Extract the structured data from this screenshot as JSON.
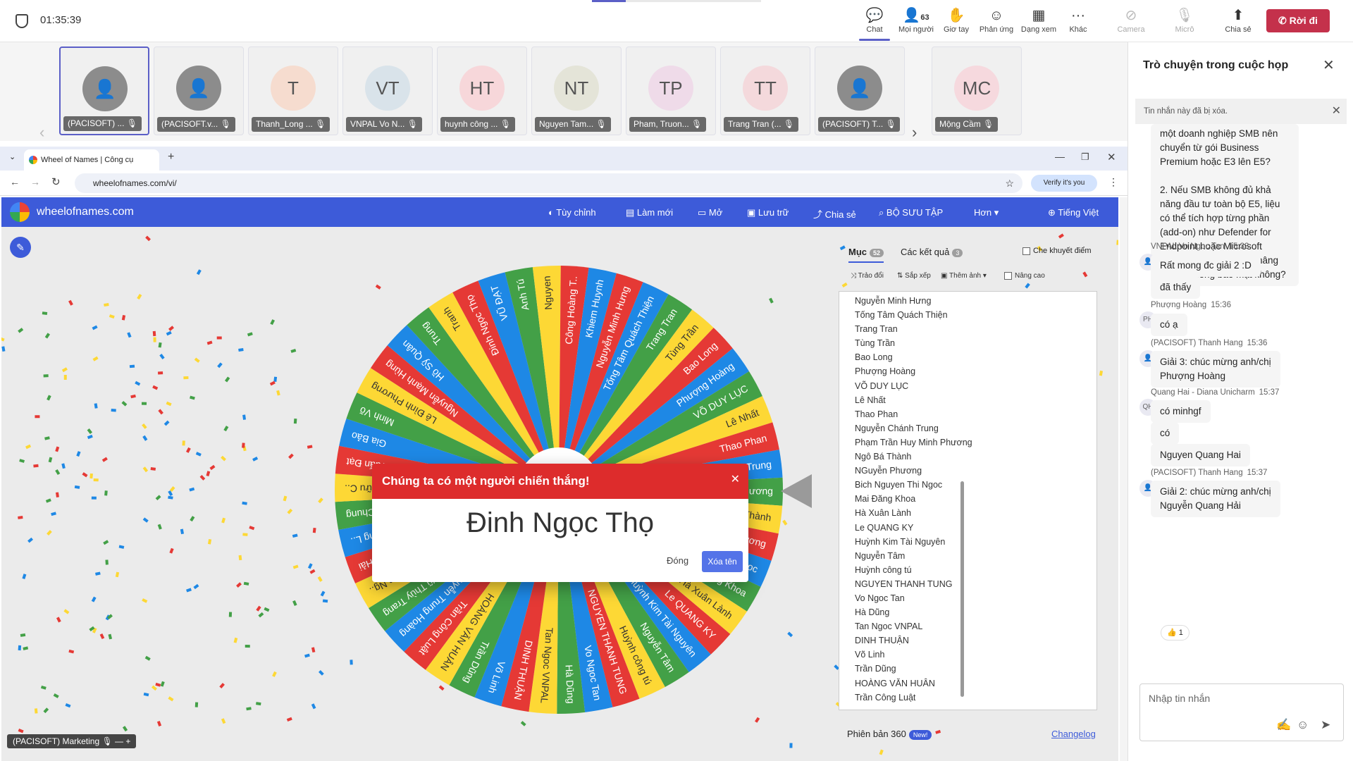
{
  "meeting": {
    "timer": "01:35:39",
    "toolbar": [
      {
        "label": "Chat",
        "icon": "chat-icon",
        "sel": true
      },
      {
        "label": "Mọi người",
        "icon": "people-icon",
        "count": "63"
      },
      {
        "label": "Giơ tay",
        "icon": "raise-hand-icon"
      },
      {
        "label": "Phản ứng",
        "icon": "reaction-icon"
      },
      {
        "label": "Dạng xem",
        "icon": "view-icon"
      },
      {
        "label": "Khác",
        "icon": "more-icon"
      },
      {
        "label": "Camera",
        "icon": "camera-off-icon",
        "off": true
      },
      {
        "label": "Micrô",
        "icon": "mic-off-icon",
        "off": true
      },
      {
        "label": "Chia sẻ",
        "icon": "share-icon"
      }
    ],
    "leave_label": "Rời đi"
  },
  "participants": [
    {
      "initials": "",
      "name": "(PACISOFT) ...",
      "color": "#8c8c8c"
    },
    {
      "initials": "",
      "name": "(PACISOFT.v...",
      "color": "#8c8c8c"
    },
    {
      "initials": "T",
      "name": "Thanh_Long ...",
      "color": "#f6dccf"
    },
    {
      "initials": "VT",
      "name": "VNPAL Vo N...",
      "color": "#d9e3ea"
    },
    {
      "initials": "HT",
      "name": "huynh công ...",
      "color": "#f7d7da"
    },
    {
      "initials": "NT",
      "name": "Nguyen Tam...",
      "color": "#e4e4d8"
    },
    {
      "initials": "TP",
      "name": "Pham, Truon...",
      "color": "#efdbe9"
    },
    {
      "initials": "TT",
      "name": "Trang Tran (...",
      "color": "#f4d9dc"
    },
    {
      "initials": "",
      "name": "(PACISOFT) T...",
      "color": "#8c8c8c"
    },
    {
      "initials": "MC",
      "name": "Mộng Cầm",
      "color": "#f6d9de"
    }
  ],
  "browser": {
    "tab_title": "Wheel of Names | Công cụ",
    "url": "wheelofnames.com/vi/",
    "verify": "Verify it's you"
  },
  "site": {
    "brand": "wheelofnames.com",
    "menu": [
      "Tùy chỉnh",
      "Làm mới",
      "Mở",
      "Lưu trữ",
      "Chia sẻ",
      "BỘ SƯU TẬP",
      "Hơn",
      "Tiếng Việt"
    ]
  },
  "wheel": {
    "colors": [
      "#e53935",
      "#1e88e5",
      "#43a047",
      "#fdd835"
    ],
    "labels": [
      "Nguyễn Minh Hưng",
      "Tống Tâm Quách Thiện",
      "Trang Tran",
      "Tùng Trần",
      "Bao Long",
      "Phượng Hoàng",
      "VÕ DUY LỤC",
      "Lê Nhất",
      "Thao Phan",
      "Nguyễn Chánh Trung",
      "Phạm Trần Huy Minh Phương",
      "Ngô Bá Thành",
      "NGuyễn Phương",
      "Bich Nguyen Thi Ngoc",
      "Mai Đăng Khoa",
      "Hà Xuân Lành",
      "Le QUANG KY",
      "Huỳnh Kim Tài Nguyên",
      "Nguyễn Tâm",
      "Huỳnh công tú",
      "NGUYEN THANH TUNG",
      "Vo Ngoc Tan",
      "Hà Dũng",
      "Tan Ngoc VNPAL",
      "DINH THUẬN",
      "Võ Linh",
      "Trần Dũng",
      "HOÀNG VĂN HUÂN",
      "Trần Công Luật",
      "Nguyễn Trung Hoàng",
      "Vũ Thùy Trang",
      "Nguyễn Thị Kim Ng..",
      "Nguyễn Quang Hải",
      "Nguyễn Đỗ Hoàng L..",
      "Nguyễn Minh Chung",
      "Phạm Trường Hữu C..",
      "Tuấn Đạt",
      "Gia Bảo",
      "Minh Võ",
      "Lê Đình Phương",
      "Nguyễn Mạnh Hùng",
      "Hồ Sỹ Quân",
      "Trung",
      "Tranh",
      "Đinh Ngọc Thọ",
      "VŨ ĐẠT",
      "Anh Tú",
      "Nguyen",
      "Công Hoàng T..",
      "Khiem Huynh"
    ]
  },
  "dialog": {
    "title": "Chúng ta có một người chiến thắng!",
    "winner": "Đinh Ngọc Thọ",
    "close_label": "Đóng",
    "remove_label": "Xóa tên"
  },
  "panel": {
    "tab_entries": "Mục",
    "entries_count": "52",
    "tab_results": "Các kết quả",
    "results_count": "3",
    "hide_label": "Che khuyết điểm",
    "tools": [
      "Trảo đổi",
      "Sắp xếp",
      "Thêm ảnh",
      "Nâng cao"
    ],
    "version": "Phiên bản 360",
    "new_badge": "New!",
    "changelog": "Changelog"
  },
  "presenter": "(PACISOFT) Marketing",
  "chat": {
    "title": "Trò chuyện trong cuộc họp",
    "notice": "Tin nhắn này đã bị xóa.",
    "partial": "một doanh nghiệp SMB nên chuyển từ gói Business Premium hoặc E3 lên E5?\n\n2. Nếu SMB không đủ khả năng đầu tư toàn bộ E5, liệu có thể tích hợp từng phần (add-on) như Defender for Endpoint hoặc Microsoft Purview để từng bước nâng cấp hệ thống bảo mật không?",
    "messages": [
      {
        "sender": "VNPAL Vo Ngoc Tan",
        "time": "15:33",
        "texts": [
          "Rất mong đc giải 2 :D",
          "đã thấy"
        ]
      },
      {
        "sender": "Phượng Hoàng",
        "time": "15:36",
        "initials": "PH",
        "texts": [
          "có ạ"
        ]
      },
      {
        "sender": "(PACISOFT) Thanh Hang",
        "time": "15:36",
        "texts": [
          "Giải 3: chúc mừng anh/chị\nPhượng Hoàng"
        ]
      },
      {
        "sender": "Quang Hai - Diana Unicharm",
        "time": "15:37",
        "initials": "QH",
        "texts": [
          "có minhgf",
          "có",
          "Nguyen Quang Hai"
        ]
      },
      {
        "sender": "(PACISOFT) Thanh Hang",
        "time": "15:37",
        "texts": [
          "Giải 2: chúc mừng anh/chị\nNguyễn Quang Hải"
        ]
      }
    ],
    "reaction": "👍 1",
    "compose_placeholder": "Nhập tin nhắn"
  }
}
